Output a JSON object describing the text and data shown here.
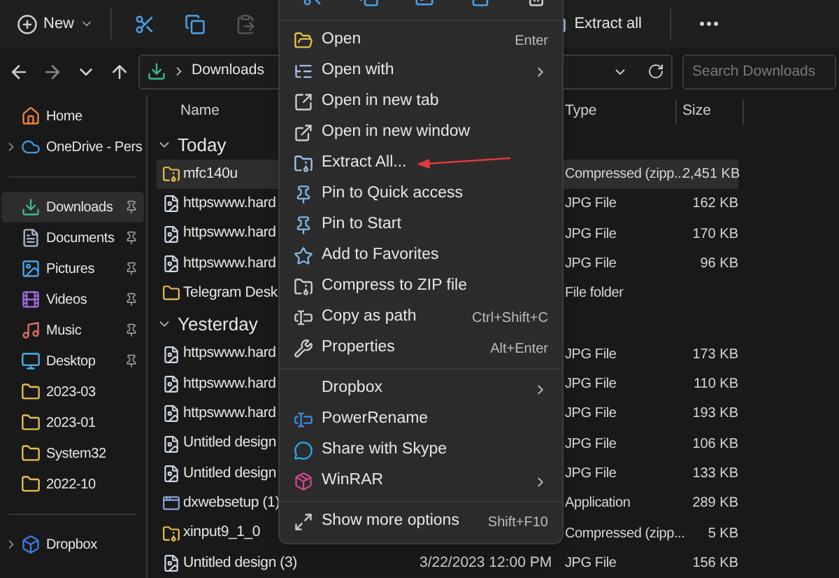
{
  "toolbar": {
    "new_label": "New",
    "extract_label": "Extract all"
  },
  "address": {
    "crumb": "Downloads",
    "search_placeholder": "Search Downloads"
  },
  "sidebar": {
    "items": [
      {
        "label": "Home",
        "selected": false,
        "pinned": false,
        "expandable": false,
        "kind": "home"
      },
      {
        "label": "OneDrive - Pers",
        "selected": false,
        "pinned": false,
        "expandable": true,
        "kind": "cloud"
      },
      {
        "label": "Downloads",
        "selected": true,
        "pinned": true,
        "expandable": false,
        "kind": "downloads"
      },
      {
        "label": "Documents",
        "selected": false,
        "pinned": true,
        "expandable": false,
        "kind": "documents"
      },
      {
        "label": "Pictures",
        "selected": false,
        "pinned": true,
        "expandable": false,
        "kind": "pictures"
      },
      {
        "label": "Videos",
        "selected": false,
        "pinned": true,
        "expandable": false,
        "kind": "videos"
      },
      {
        "label": "Music",
        "selected": false,
        "pinned": true,
        "expandable": false,
        "kind": "music"
      },
      {
        "label": "Desktop",
        "selected": false,
        "pinned": true,
        "expandable": false,
        "kind": "desktop"
      },
      {
        "label": "2023-03",
        "selected": false,
        "pinned": false,
        "expandable": false,
        "kind": "folder"
      },
      {
        "label": "2023-01",
        "selected": false,
        "pinned": false,
        "expandable": false,
        "kind": "folder"
      },
      {
        "label": "System32",
        "selected": false,
        "pinned": false,
        "expandable": false,
        "kind": "folder"
      },
      {
        "label": "2022-10",
        "selected": false,
        "pinned": false,
        "expandable": false,
        "kind": "folder"
      },
      {
        "label": "Dropbox",
        "selected": false,
        "pinned": false,
        "expandable": true,
        "kind": "dropbox"
      }
    ]
  },
  "table": {
    "columns": [
      "Name",
      "Type",
      "Size"
    ],
    "groups": [
      {
        "label": "Today",
        "expanded": true,
        "rows": [
          {
            "name": "mfc140u",
            "kind": "zip",
            "type": "Compressed (zipp...",
            "size": "2,451 KB",
            "selected": true
          },
          {
            "name": "httpswww.hard",
            "kind": "image",
            "type": "JPG File",
            "size": "162 KB",
            "selected": false
          },
          {
            "name": "httpswww.hard",
            "kind": "image",
            "type": "JPG File",
            "size": "170 KB",
            "selected": false
          },
          {
            "name": "httpswww.hard",
            "kind": "image",
            "type": "JPG File",
            "size": "96 KB",
            "selected": false
          },
          {
            "name": "Telegram Desk",
            "kind": "folder",
            "type": "File folder",
            "selected": false
          }
        ]
      },
      {
        "label": "Yesterday",
        "expanded": true,
        "rows": [
          {
            "name": "httpswww.hard",
            "kind": "image",
            "type": "JPG File",
            "size": "173 KB",
            "selected": false
          },
          {
            "name": "httpswww.hard",
            "kind": "image",
            "type": "JPG File",
            "size": "110 KB",
            "selected": false
          },
          {
            "name": "httpswww.hard",
            "kind": "image",
            "type": "JPG File",
            "size": "193 KB",
            "selected": false
          },
          {
            "name": "Untitled design",
            "kind": "image",
            "type": "JPG File",
            "size": "106 KB",
            "selected": false
          },
          {
            "name": "Untitled design",
            "kind": "image",
            "type": "JPG File",
            "size": "133 KB",
            "selected": false
          },
          {
            "name": "dxwebsetup (1)",
            "kind": "app",
            "type": "Application",
            "size": "289 KB",
            "selected": false
          },
          {
            "name": "xinput9_1_0",
            "kind": "zip",
            "type": "Compressed (zipp...",
            "size": "5 KB",
            "selected": false
          },
          {
            "name": "Untitled design (3)",
            "kind": "image",
            "date": "3/22/2023 12:00 PM",
            "type": "JPG File",
            "size": "156 KB",
            "selected": false
          }
        ]
      }
    ]
  },
  "context_menu": {
    "items": [
      {
        "kind": "item",
        "label": "Open",
        "shortcut": "Enter",
        "submenu": false
      },
      {
        "kind": "item",
        "label": "Open with",
        "submenu": true
      },
      {
        "kind": "item",
        "label": "Open in new tab",
        "submenu": false
      },
      {
        "kind": "item",
        "label": "Open in new window",
        "submenu": false
      },
      {
        "kind": "item",
        "label": "Extract All...",
        "submenu": false
      },
      {
        "kind": "item",
        "label": "Pin to Quick access",
        "submenu": false
      },
      {
        "kind": "item",
        "label": "Pin to Start",
        "submenu": false
      },
      {
        "kind": "item",
        "label": "Add to Favorites",
        "submenu": false
      },
      {
        "kind": "item",
        "label": "Compress to ZIP file",
        "submenu": false
      },
      {
        "kind": "item",
        "label": "Copy as path",
        "shortcut": "Ctrl+Shift+C",
        "submenu": false
      },
      {
        "kind": "item",
        "label": "Properties",
        "shortcut": "Alt+Enter",
        "submenu": false
      },
      {
        "kind": "separator"
      },
      {
        "kind": "item",
        "label": "Dropbox",
        "submenu": true
      },
      {
        "kind": "item",
        "label": "PowerRename",
        "submenu": false
      },
      {
        "kind": "item",
        "label": "Share with Skype",
        "submenu": false
      },
      {
        "kind": "item",
        "label": "WinRAR",
        "submenu": true
      },
      {
        "kind": "separator"
      },
      {
        "kind": "item",
        "label": "Show more options",
        "shortcut": "Shift+F10",
        "submenu": false
      }
    ]
  }
}
